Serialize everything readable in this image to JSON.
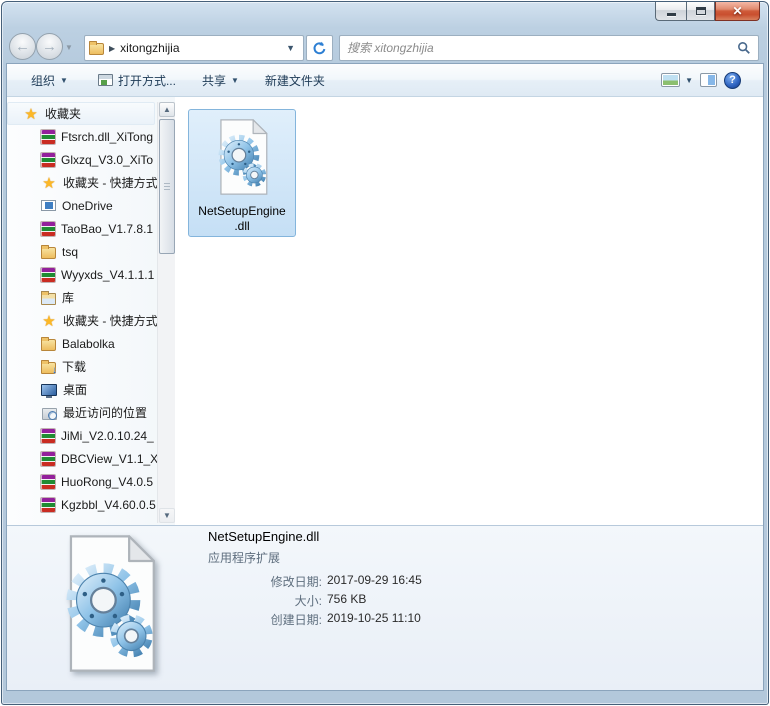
{
  "navigation": {
    "address": {
      "path": "xitongzhijia"
    },
    "search": {
      "placeholder": "搜索 xitongzhijia"
    }
  },
  "toolbar": {
    "organize": "组织",
    "open_with": "打开方式...",
    "share": "共享",
    "new_folder": "新建文件夹"
  },
  "sidebar": {
    "items": [
      {
        "label": "收藏夹",
        "icon": "star-icon"
      },
      {
        "label": "Ftsrch.dll_XiTong",
        "icon": "winrar-archive-icon"
      },
      {
        "label": "Glxzq_V3.0_XiTo",
        "icon": "winrar-archive-icon"
      },
      {
        "label": "收藏夹 - 快捷方式",
        "icon": "star-icon"
      },
      {
        "label": "OneDrive",
        "icon": "onedrive-icon"
      },
      {
        "label": "TaoBao_V1.7.8.1",
        "icon": "winrar-archive-icon"
      },
      {
        "label": "tsq",
        "icon": "folder-icon"
      },
      {
        "label": "Wyyxds_V4.1.1.1",
        "icon": "winrar-archive-icon"
      },
      {
        "label": "库",
        "icon": "library-icon"
      },
      {
        "label": "收藏夹 - 快捷方式",
        "icon": "star-icon"
      },
      {
        "label": "Balabolka",
        "icon": "folder-icon"
      },
      {
        "label": "下载",
        "icon": "downloads-folder-icon"
      },
      {
        "label": "桌面",
        "icon": "desktop-icon"
      },
      {
        "label": "最近访问的位置",
        "icon": "recent-places-icon"
      },
      {
        "label": "JiMi_V2.0.10.24_",
        "icon": "winrar-archive-icon"
      },
      {
        "label": "DBCView_V1.1_X",
        "icon": "winrar-archive-icon"
      },
      {
        "label": "HuoRong_V4.0.5",
        "icon": "winrar-archive-icon"
      },
      {
        "label": "Kgzbbl_V4.60.0.5",
        "icon": "winrar-archive-icon"
      }
    ]
  },
  "main": {
    "file": {
      "name_line1": "NetSetupEngine",
      "name_line2": ".dll"
    }
  },
  "details": {
    "filename": "NetSetupEngine.dll",
    "file_type": "应用程序扩展",
    "fields": [
      {
        "label": "修改日期:",
        "value": "2017-09-29 16:45"
      },
      {
        "label": "大小:",
        "value": "756 KB"
      },
      {
        "label": "创建日期:",
        "value": "2019-10-25 11:10"
      }
    ]
  }
}
